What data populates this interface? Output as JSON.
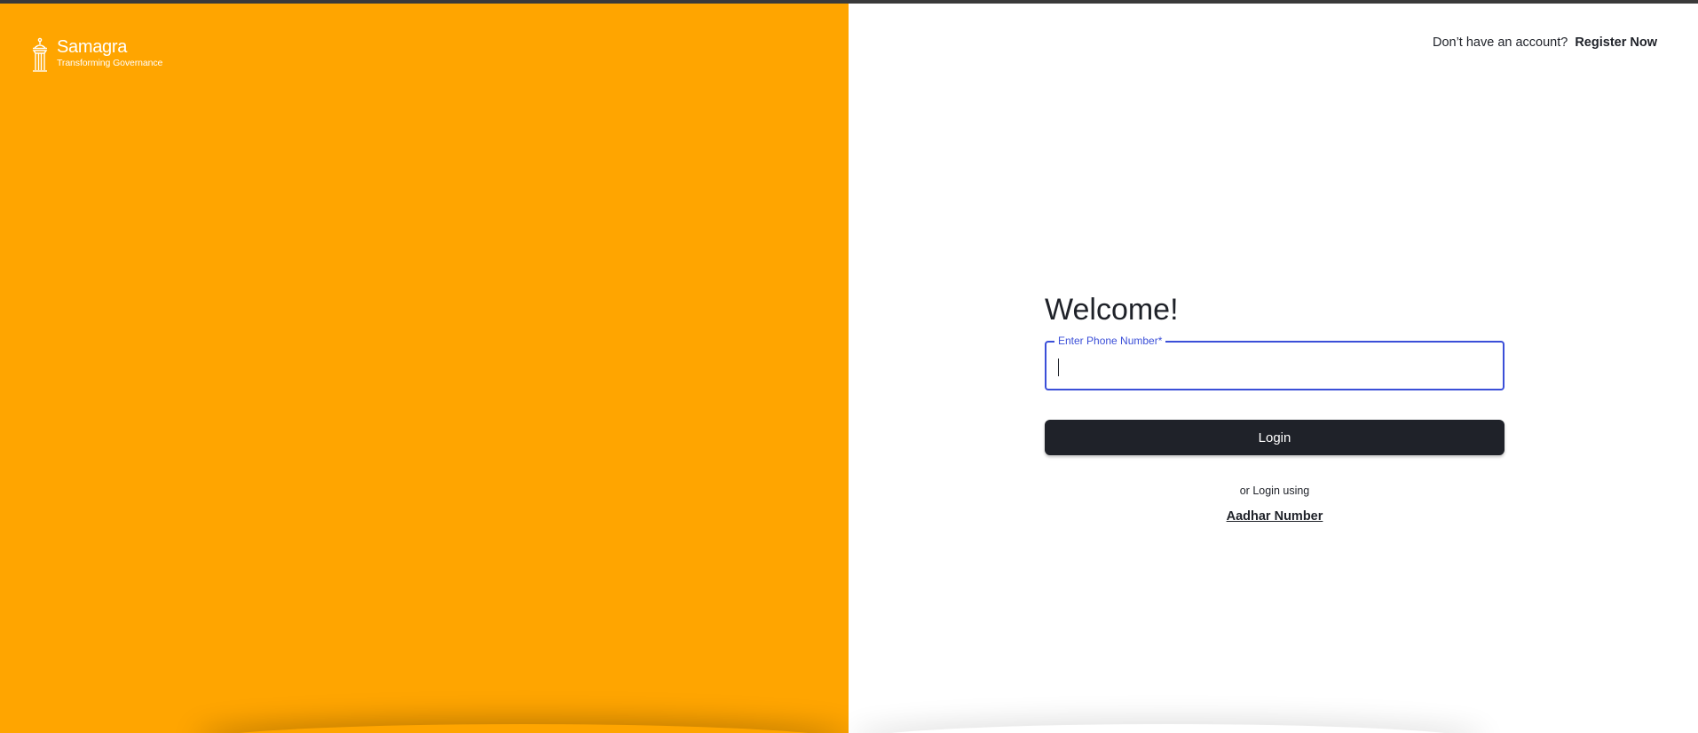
{
  "brand": {
    "name": "Samagra",
    "tagline": "Transforming Governance",
    "icon": "samagra-pillar-icon",
    "accent_color": "#ffa500"
  },
  "header": {
    "register_prompt": "Don’t have an account?",
    "register_link": "Register Now"
  },
  "form": {
    "title": "Welcome!",
    "phone_label": "Enter Phone Number",
    "phone_required_marker": "*",
    "phone_value": "",
    "login_button": "Login",
    "alt_login_text": "or Login using",
    "alt_login_link": "Aadhar Number"
  },
  "colors": {
    "primary_dark": "#1f2229",
    "focus_blue": "#3b4fd8"
  }
}
